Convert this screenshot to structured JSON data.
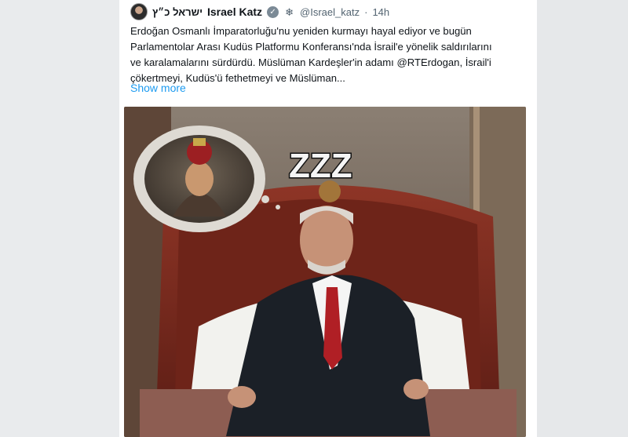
{
  "tweet": {
    "author_name_hebrew": "ישראל כ״ץ",
    "author_name": "Israel Katz",
    "handle": "@Israel_katz",
    "separator": "·",
    "time": "14h",
    "verified_icon": "verified-badge-icon",
    "affiliation_icon": "government-flag-icon",
    "text_lines": [
      "Erdoğan Osmanlı İmparatorluğu'nu yeniden kurmayı hayal ediyor ve bugün",
      "Parlamentolar Arası Kudüs Platformu Konferansı'nda İsrail'e yönelik saldırılarını",
      "ve karalamalarını sürdürdü. Müslüman Kardeşler'in adamı @RTErdogan, İsrail'i",
      "çökertmeyi, Kudüs'ü fethetmeyi ve Müslüman..."
    ],
    "show_more": "Show more"
  },
  "image": {
    "sleep_text": "ZZZ",
    "description_icon": "sleeping-leader-illustration"
  },
  "colors": {
    "link": "#1d9bf0",
    "text": "#0f1419",
    "muted": "#536471",
    "headboard": "#7a2a1f",
    "pillow": "#f2f2ee",
    "suit": "#1b2027",
    "tie": "#b01f25"
  }
}
